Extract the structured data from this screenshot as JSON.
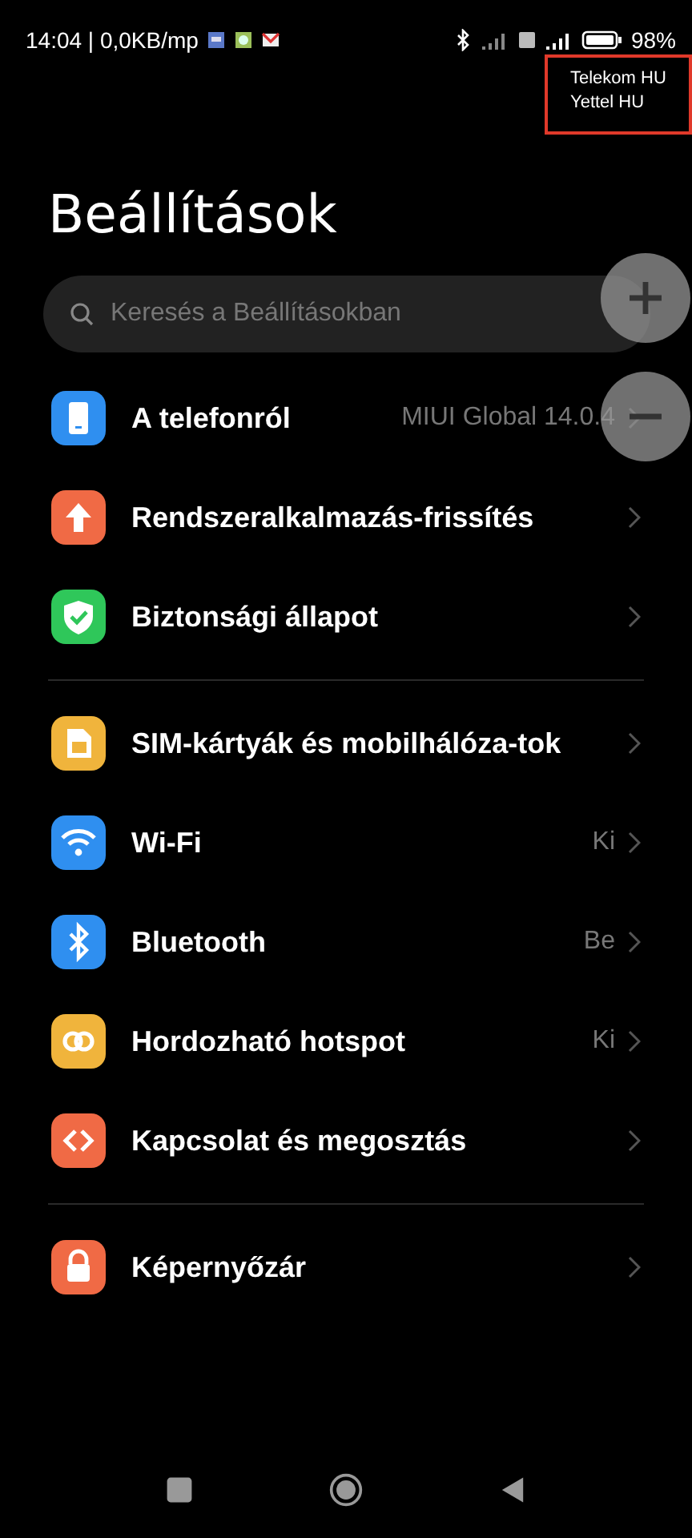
{
  "status_bar": {
    "time": "14:04 | 0,0KB/mp",
    "battery": "98%"
  },
  "sim_overlay": {
    "lines": [
      "Telekom HU",
      "Yettel HU"
    ]
  },
  "title": "Beállítások",
  "search": {
    "placeholder": "Keresés a Beállításokban"
  },
  "groups": [
    [
      {
        "label": "A telefonról",
        "value": "MIUI Global 14.0.4",
        "color": "#2f8ff0"
      },
      {
        "label": "Rendszeralkalmazás-frissítés",
        "color": "#f06a45"
      },
      {
        "label": "Biztonsági állapot",
        "color": "#2fc75a"
      }
    ],
    [
      {
        "label": "SIM-kártyák és mobilhálóza-tok",
        "color": "#f0b43c"
      },
      {
        "label": "Wi-Fi",
        "value": "Ki",
        "color": "#2f8ff0"
      },
      {
        "label": "Bluetooth",
        "value": "Be",
        "color": "#2f8ff0"
      },
      {
        "label": "Hordozható hotspot",
        "value": "Ki",
        "color": "#f0b43c"
      },
      {
        "label": "Kapcsolat és megosztás",
        "color": "#f06a45"
      }
    ],
    [
      {
        "label": "Képernyőzár",
        "color": "#f06a45"
      }
    ]
  ]
}
